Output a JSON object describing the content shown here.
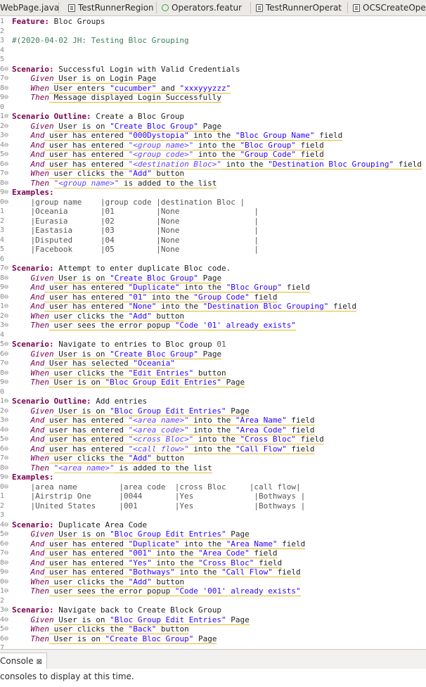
{
  "tabs": [
    {
      "label": "WebPage.java",
      "icon": "java-file-icon"
    },
    {
      "label": "TestRunnerRegion",
      "icon": "java-file-icon"
    },
    {
      "label": "Operators.featur",
      "icon": "feature-file-icon"
    },
    {
      "label": "TestRunnerOperat",
      "icon": "java-file-icon"
    },
    {
      "label": "OCSCreateOpera",
      "icon": "java-file-icon"
    }
  ],
  "lines": [
    {
      "n": "1",
      "segs": [
        [
          "Feature:",
          "kw"
        ],
        [
          " Bloc Groups",
          ""
        ]
      ]
    },
    {
      "n": "2",
      "segs": []
    },
    {
      "n": "3",
      "segs": [
        [
          "#(2020-04-02 JH: Testing Bloc Grouping",
          "cmt"
        ]
      ]
    },
    {
      "n": "4",
      "segs": []
    },
    {
      "n": "5",
      "segs": []
    },
    {
      "n": "6⊖",
      "segs": [
        [
          "Scenario:",
          "kw"
        ],
        [
          " Successful Login with Valid Credentials",
          ""
        ]
      ]
    },
    {
      "n": "7⊖",
      "segs": [
        [
          "    ",
          ""
        ],
        [
          "Given",
          "step"
        ],
        [
          " User is on Login Page",
          "ul"
        ]
      ]
    },
    {
      "n": "8⊖",
      "segs": [
        [
          "    ",
          ""
        ],
        [
          "When",
          "step"
        ],
        [
          " User enters ",
          "ul"
        ],
        [
          "\"cucumber\"",
          "str ul"
        ],
        [
          " and ",
          "ul"
        ],
        [
          "\"xxxyyyzzz\"",
          "str ul"
        ]
      ]
    },
    {
      "n": "9⊖",
      "segs": [
        [
          "    ",
          ""
        ],
        [
          "Then",
          "step"
        ],
        [
          " Message displayed Login Successfully",
          "ul"
        ]
      ]
    },
    {
      "n": "0",
      "segs": []
    },
    {
      "n": "1⊖",
      "segs": [
        [
          "Scenario Outline:",
          "kw"
        ],
        [
          " Create a Bloc Group",
          ""
        ]
      ]
    },
    {
      "n": "2⊖",
      "segs": [
        [
          "    ",
          ""
        ],
        [
          "Given",
          "step"
        ],
        [
          " User is on ",
          "ul"
        ],
        [
          "\"Create Bloc Group\"",
          "str ul"
        ],
        [
          " Page",
          "ul"
        ]
      ]
    },
    {
      "n": "3⊖",
      "segs": [
        [
          "    ",
          ""
        ],
        [
          "And",
          "step"
        ],
        [
          " user has entered ",
          "ul"
        ],
        [
          "\"000Dystopia\"",
          "str ul"
        ],
        [
          " into the ",
          "ul"
        ],
        [
          "\"Bloc Group Name\"",
          "str ul"
        ],
        [
          " field",
          "ul"
        ]
      ]
    },
    {
      "n": "4⊖",
      "segs": [
        [
          "    ",
          ""
        ],
        [
          "And",
          "step"
        ],
        [
          " user has entered ",
          "ul"
        ],
        [
          "\"<group name>\"",
          "ph ul"
        ],
        [
          " into the ",
          "ul"
        ],
        [
          "\"Bloc Group\"",
          "str ul"
        ],
        [
          " field",
          "ul"
        ]
      ]
    },
    {
      "n": "5⊖",
      "segs": [
        [
          "    ",
          ""
        ],
        [
          "And",
          "step"
        ],
        [
          " user has entered ",
          "ul"
        ],
        [
          "\"<group code>\"",
          "ph ul"
        ],
        [
          " into the ",
          "ul"
        ],
        [
          "\"Group Code\"",
          "str ul"
        ],
        [
          " field",
          "ul"
        ]
      ]
    },
    {
      "n": "6⊖",
      "segs": [
        [
          "    ",
          ""
        ],
        [
          "And",
          "step"
        ],
        [
          " user has entered ",
          "ul"
        ],
        [
          "\"<destination Bloc>\"",
          "ph ul"
        ],
        [
          " into the ",
          "ul"
        ],
        [
          "\"Destination Bloc Grouping\"",
          "str ul"
        ],
        [
          " field",
          "ul"
        ]
      ]
    },
    {
      "n": "7⊖",
      "segs": [
        [
          "    ",
          ""
        ],
        [
          "When",
          "step"
        ],
        [
          " user clicks the ",
          "ul"
        ],
        [
          "\"Add\"",
          "str ul"
        ],
        [
          " button",
          "ul"
        ]
      ]
    },
    {
      "n": "8⊖",
      "segs": [
        [
          "    ",
          ""
        ],
        [
          "Then",
          "step"
        ],
        [
          " ",
          ""
        ],
        [
          "\"<group name>\"",
          "ph ul"
        ],
        [
          " is added to the list",
          "ul"
        ]
      ]
    },
    {
      "n": "9⊖",
      "segs": [
        [
          "Examples:",
          "kw"
        ]
      ]
    },
    {
      "n": "0⊖",
      "segs": [
        [
          "    |group name    |group code |destination Bloc |",
          "tbl"
        ]
      ]
    },
    {
      "n": "1",
      "segs": [
        [
          "    |Oceania       |01         |None                |",
          "tbl"
        ]
      ]
    },
    {
      "n": "2",
      "segs": [
        [
          "    |Eurasia       |02         |None                |",
          "tbl"
        ]
      ]
    },
    {
      "n": "3",
      "segs": [
        [
          "    |Eastasia      |03         |None                |",
          "tbl"
        ]
      ]
    },
    {
      "n": "4",
      "segs": [
        [
          "    |Disputed      |04         |None                |",
          "tbl"
        ]
      ]
    },
    {
      "n": "5",
      "segs": [
        [
          "    |Facebook      |05         |None                |",
          "tbl"
        ]
      ]
    },
    {
      "n": "6",
      "segs": []
    },
    {
      "n": "7⊖",
      "segs": [
        [
          "Scenario:",
          "kw"
        ],
        [
          " Attempt to enter duplicate Bloc code.",
          ""
        ]
      ]
    },
    {
      "n": "8⊖",
      "segs": [
        [
          "    ",
          ""
        ],
        [
          "Given",
          "step"
        ],
        [
          " User is on ",
          "ul"
        ],
        [
          "\"Create Bloc Group\"",
          "str ul"
        ],
        [
          " Page",
          "ul"
        ]
      ]
    },
    {
      "n": "9⊖",
      "segs": [
        [
          "    ",
          ""
        ],
        [
          "And",
          "step"
        ],
        [
          " user has entered ",
          "ul"
        ],
        [
          "\"Duplicate\"",
          "str ul"
        ],
        [
          " into the ",
          "ul"
        ],
        [
          "\"Bloc Group\"",
          "str ul"
        ],
        [
          " field",
          "ul"
        ]
      ]
    },
    {
      "n": "0⊖",
      "segs": [
        [
          "    ",
          ""
        ],
        [
          "And",
          "step"
        ],
        [
          " user has entered ",
          "ul"
        ],
        [
          "\"01\"",
          "str ul"
        ],
        [
          " into the ",
          "ul"
        ],
        [
          "\"Group Code\"",
          "str ul"
        ],
        [
          " field",
          "ul"
        ]
      ]
    },
    {
      "n": "1⊖",
      "segs": [
        [
          "    ",
          ""
        ],
        [
          "And",
          "step"
        ],
        [
          " user has entered ",
          "ul"
        ],
        [
          "\"None\"",
          "str ul"
        ],
        [
          " into the ",
          "ul"
        ],
        [
          "\"Destination Bloc Grouping\"",
          "str ul"
        ],
        [
          " field",
          "ul"
        ]
      ]
    },
    {
      "n": "2⊖",
      "segs": [
        [
          "    ",
          ""
        ],
        [
          "When",
          "step"
        ],
        [
          " user clicks the ",
          "ul"
        ],
        [
          "\"Add\"",
          "str ul"
        ],
        [
          " button",
          "ul"
        ]
      ]
    },
    {
      "n": "3⊖",
      "segs": [
        [
          "    ",
          ""
        ],
        [
          "Then",
          "step"
        ],
        [
          " user sees the error popup ",
          "ul"
        ],
        [
          "\"Code '01' already exists\"",
          "str ul"
        ]
      ]
    },
    {
      "n": "4",
      "segs": []
    },
    {
      "n": "5⊖",
      "segs": [
        [
          "Scenario:",
          "kw"
        ],
        [
          " Navigate to entries to Bloc group ",
          ""
        ],
        [
          "01",
          "tbl"
        ]
      ]
    },
    {
      "n": "6⊖",
      "segs": [
        [
          "    ",
          ""
        ],
        [
          "Given",
          "step"
        ],
        [
          " User is on ",
          "ul"
        ],
        [
          "\"Create Bloc Group\"",
          "str ul"
        ],
        [
          " Page",
          "ul"
        ]
      ]
    },
    {
      "n": "7⊖",
      "segs": [
        [
          "    ",
          ""
        ],
        [
          "And",
          "step"
        ],
        [
          " User has selected ",
          "ul"
        ],
        [
          "\"Oceania\"",
          "str ul"
        ]
      ]
    },
    {
      "n": "8⊖",
      "segs": [
        [
          "    ",
          ""
        ],
        [
          "When",
          "step"
        ],
        [
          " user clicks the ",
          "ul"
        ],
        [
          "\"Edit Entries\"",
          "str ul"
        ],
        [
          " button",
          "ul"
        ]
      ]
    },
    {
      "n": "9⊖",
      "segs": [
        [
          "    ",
          ""
        ],
        [
          "Then",
          "step"
        ],
        [
          " User is on ",
          "ul"
        ],
        [
          "\"Bloc Group Edit Entries\"",
          "str ul"
        ],
        [
          " Page",
          "ul"
        ]
      ]
    },
    {
      "n": "0",
      "segs": []
    },
    {
      "n": "1⊖",
      "segs": [
        [
          "Scenario Outline:",
          "kw"
        ],
        [
          " Add entries",
          ""
        ]
      ]
    },
    {
      "n": "2⊖",
      "segs": [
        [
          "    ",
          ""
        ],
        [
          "Given",
          "step"
        ],
        [
          " User is on ",
          "ul"
        ],
        [
          "\"Bloc Group Edit Entries\"",
          "str ul"
        ],
        [
          " Page",
          "ul"
        ]
      ]
    },
    {
      "n": "3⊖",
      "segs": [
        [
          "    ",
          ""
        ],
        [
          "And",
          "step"
        ],
        [
          " user has entered ",
          "ul"
        ],
        [
          "\"<area name>\"",
          "ph ul"
        ],
        [
          " into the ",
          "ul"
        ],
        [
          "\"Area Name\"",
          "str ul"
        ],
        [
          " field",
          "ul"
        ]
      ]
    },
    {
      "n": "4⊖",
      "segs": [
        [
          "    ",
          ""
        ],
        [
          "And",
          "step"
        ],
        [
          " user has entered ",
          "ul"
        ],
        [
          "\"<area code>\"",
          "ph ul"
        ],
        [
          " into the ",
          "ul"
        ],
        [
          "\"Area Code\"",
          "str ul"
        ],
        [
          " field",
          "ul"
        ]
      ]
    },
    {
      "n": "5⊖",
      "segs": [
        [
          "    ",
          ""
        ],
        [
          "And",
          "step"
        ],
        [
          " user has entered ",
          "ul"
        ],
        [
          "\"<cross Bloc>\"",
          "ph ul"
        ],
        [
          " into the ",
          "ul"
        ],
        [
          "\"Cross Bloc\"",
          "str ul"
        ],
        [
          " field",
          "ul"
        ]
      ]
    },
    {
      "n": "6⊖",
      "segs": [
        [
          "    ",
          ""
        ],
        [
          "And",
          "step"
        ],
        [
          " user has entered ",
          "ul"
        ],
        [
          "\"<call flow>\"",
          "ph ul"
        ],
        [
          " into the ",
          "ul"
        ],
        [
          "\"Call Flow\"",
          "str ul"
        ],
        [
          " field",
          "ul"
        ]
      ]
    },
    {
      "n": "7⊖",
      "segs": [
        [
          "    ",
          ""
        ],
        [
          "When",
          "step"
        ],
        [
          " user clicks the ",
          "ul"
        ],
        [
          "\"Add\"",
          "str ul"
        ],
        [
          " button",
          "ul"
        ]
      ]
    },
    {
      "n": "8⊖",
      "segs": [
        [
          "    ",
          ""
        ],
        [
          "Then",
          "step"
        ],
        [
          " ",
          ""
        ],
        [
          "\"<area name>\"",
          "ph ul"
        ],
        [
          " is added to the list",
          "ul"
        ]
      ]
    },
    {
      "n": "9⊖",
      "segs": [
        [
          "Examples:",
          "kw"
        ]
      ]
    },
    {
      "n": "0⊖",
      "segs": [
        [
          "    |area name         |area code  |cross Bloc     |call flow|",
          "tbl"
        ]
      ]
    },
    {
      "n": "1",
      "segs": [
        [
          "    |Airstrip One      |0044       |Yes             |Bothways |",
          "tbl"
        ]
      ]
    },
    {
      "n": "2",
      "segs": [
        [
          "    |United States     |001        |Yes             |Bothways |",
          "tbl"
        ]
      ]
    },
    {
      "n": "3",
      "segs": []
    },
    {
      "n": "4⊖",
      "segs": [
        [
          "Scenario:",
          "kw"
        ],
        [
          " Duplicate Area Code",
          ""
        ]
      ]
    },
    {
      "n": "5⊖",
      "segs": [
        [
          "    ",
          ""
        ],
        [
          "Given",
          "step"
        ],
        [
          " User is on ",
          "ul"
        ],
        [
          "\"Bloc Group Edit Entries\"",
          "str ul"
        ],
        [
          " Page",
          "ul"
        ]
      ]
    },
    {
      "n": "6⊖",
      "segs": [
        [
          "    ",
          ""
        ],
        [
          "And",
          "step"
        ],
        [
          " user has entered ",
          "ul"
        ],
        [
          "\"Duplicate\"",
          "str ul"
        ],
        [
          " into the ",
          "ul"
        ],
        [
          "\"Area Name\"",
          "str ul"
        ],
        [
          " field",
          "ul"
        ]
      ]
    },
    {
      "n": "7⊖",
      "segs": [
        [
          "    ",
          ""
        ],
        [
          "And",
          "step"
        ],
        [
          " user has entered ",
          "ul"
        ],
        [
          "\"001\"",
          "str ul"
        ],
        [
          " into the ",
          "ul"
        ],
        [
          "\"Area Code\"",
          "str ul"
        ],
        [
          " field",
          "ul"
        ]
      ]
    },
    {
      "n": "8⊖",
      "segs": [
        [
          "    ",
          ""
        ],
        [
          "And",
          "step"
        ],
        [
          " user has entered ",
          "ul"
        ],
        [
          "\"Yes\"",
          "str ul"
        ],
        [
          " into the ",
          "ul"
        ],
        [
          "\"Cross Bloc\"",
          "str ul"
        ],
        [
          " field",
          "ul"
        ]
      ]
    },
    {
      "n": "9⊖",
      "segs": [
        [
          "    ",
          ""
        ],
        [
          "And",
          "step"
        ],
        [
          " user has entered ",
          "ul"
        ],
        [
          "\"Bothways\"",
          "str ul"
        ],
        [
          " into the ",
          "ul"
        ],
        [
          "\"Call Flow\"",
          "str ul"
        ],
        [
          " field",
          "ul"
        ]
      ]
    },
    {
      "n": "0⊖",
      "segs": [
        [
          "    ",
          ""
        ],
        [
          "When",
          "step"
        ],
        [
          " user clicks the ",
          "ul"
        ],
        [
          "\"Add\"",
          "str ul"
        ],
        [
          " button",
          "ul"
        ]
      ]
    },
    {
      "n": "1⊖",
      "segs": [
        [
          "    ",
          ""
        ],
        [
          "Then",
          "step"
        ],
        [
          " user sees the error popup ",
          "ul"
        ],
        [
          "\"Code '001' already exists\"",
          "str ul"
        ]
      ]
    },
    {
      "n": "2",
      "segs": []
    },
    {
      "n": "3⊖",
      "segs": [
        [
          "Scenario:",
          "kw"
        ],
        [
          " Navigate back to Create Block Group",
          ""
        ]
      ]
    },
    {
      "n": "4⊖",
      "segs": [
        [
          "    ",
          ""
        ],
        [
          "Given",
          "step"
        ],
        [
          " User is on ",
          "ul"
        ],
        [
          "\"Bloc Group Edit Entries\"",
          "str ul"
        ],
        [
          " Page",
          "ul"
        ]
      ]
    },
    {
      "n": "5⊖",
      "segs": [
        [
          "    ",
          ""
        ],
        [
          "When",
          "step"
        ],
        [
          " user clicks the ",
          "ul"
        ],
        [
          "\"Back\"",
          "str ul"
        ],
        [
          " button",
          "ul"
        ]
      ]
    },
    {
      "n": "6⊖",
      "segs": [
        [
          "    ",
          ""
        ],
        [
          "Then",
          "step"
        ],
        [
          " User is on ",
          "ul"
        ],
        [
          "\"Create Bloc Group\"",
          "str ul"
        ],
        [
          " Page",
          "ul"
        ]
      ]
    },
    {
      "n": "7",
      "segs": []
    }
  ],
  "console": {
    "tab_label": "Console",
    "close_glyph": "⊠",
    "message": "consoles to display at this time."
  },
  "colors": {
    "keyword": "#7a0050",
    "string": "#2a00ff",
    "comment": "#3f7f5f",
    "step_underline": "#e8b92a"
  }
}
